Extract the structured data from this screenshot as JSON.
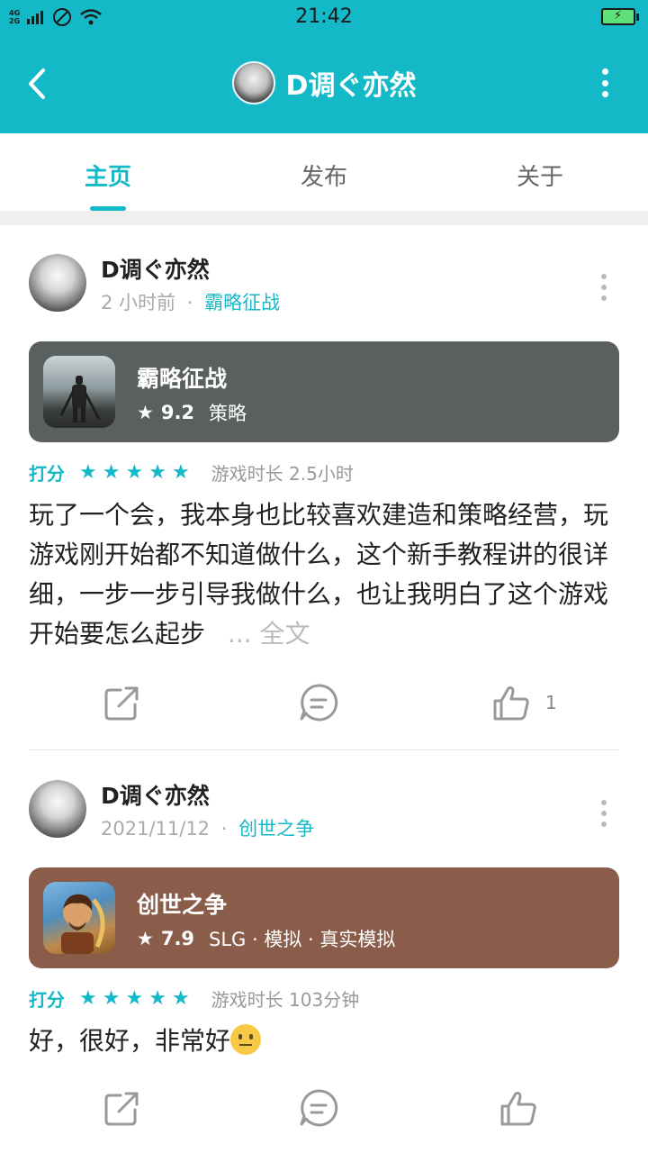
{
  "status": {
    "net_top": "4G",
    "net_bottom": "2G",
    "time": "21:42"
  },
  "header": {
    "title": "D调ぐ亦然"
  },
  "tabs": [
    {
      "label": "主页"
    },
    {
      "label": "发布"
    },
    {
      "label": "关于"
    }
  ],
  "posts": [
    {
      "author": "D调ぐ亦然",
      "time": "2 小时前",
      "separator": "·",
      "game_link": "霸略征战",
      "game": {
        "name": "霸略征战",
        "score": "9.2",
        "tags": "策略",
        "color": "#5a5f60"
      },
      "rating_label": "打分",
      "stars": 5,
      "playtime": "游戏时长 2.5小时",
      "content": "玩了一个会，我本身也比较喜欢建造和策略经营，玩游戏刚开始都不知道做什么，这个新手教程讲的很详细，一步一步引导我做什么，也让我明白了这个游戏开始要怎么起步",
      "more": "... 全文",
      "likes": "1"
    },
    {
      "author": "D调ぐ亦然",
      "time": "2021/11/12",
      "separator": "·",
      "game_link": "创世之争",
      "game": {
        "name": "创世之争",
        "score": "7.9",
        "tags": "SLG · 模拟 · 真实模拟",
        "color": "#8a5c4a"
      },
      "rating_label": "打分",
      "stars": 5,
      "playtime": "游戏时长 103分钟",
      "content": "好，很好，非常好",
      "more": "",
      "likes": ""
    }
  ]
}
